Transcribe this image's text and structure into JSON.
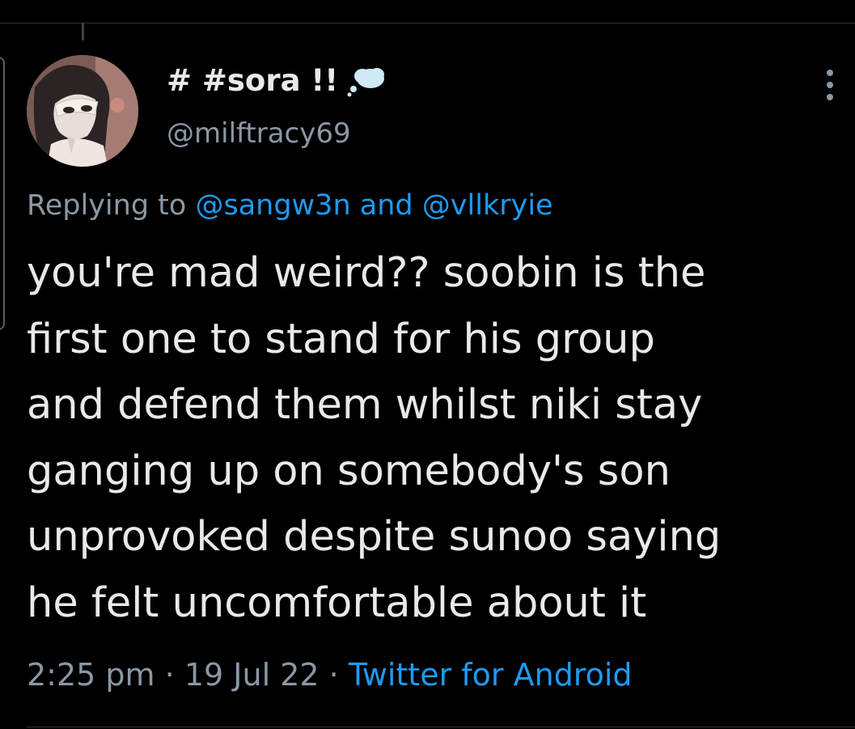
{
  "author": {
    "display_name": "# #sora !!",
    "handle": "@milftracy69",
    "badge_icon": "thought-bubble-icon"
  },
  "reply": {
    "prefix": "Replying to",
    "mention_1": "@sangw3n",
    "joiner": "and",
    "mention_2": "@vllkryie"
  },
  "tweet": {
    "lines": [
      "you're mad weird?? soobin is the",
      "first one to stand for his group",
      "and defend them whilst niki stay",
      "ganging up on somebody's son",
      "unprovoked despite sunoo saying",
      "he felt uncomfortable about it"
    ]
  },
  "meta": {
    "time": "2:25 pm",
    "separator": "·",
    "date": "19 Jul 22",
    "source": "Twitter for Android"
  },
  "colors": {
    "background": "#000000",
    "text": "#e7e9ea",
    "muted": "#8b98a5",
    "link": "#1d9bf0"
  }
}
